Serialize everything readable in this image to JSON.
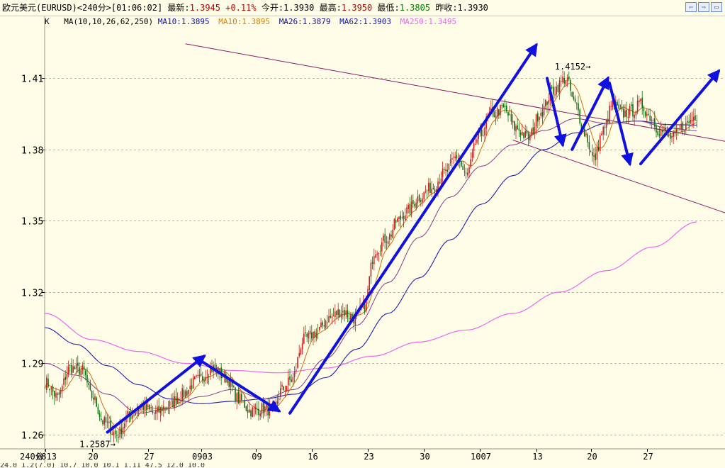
{
  "header": {
    "symbol": "欧元美元(EURUSD)<240分>",
    "time": "[01:06:02]",
    "latest_label": "最新:",
    "latest_value": "1.3945",
    "change": "+0.11%",
    "open_label": "今开:",
    "open_value": "1.3930",
    "high_label": "最高:",
    "high_value": "1.3950",
    "low_label": "最低:",
    "low_value": "1.3805",
    "prevclose_label": "昨收:",
    "prevclose_value": "1.3930"
  },
  "ma_legend": {
    "k_label": "K",
    "ma_def": "MA(10,10,26,62,250)",
    "items": [
      {
        "text": "MA10:1.3895",
        "color": "#1010c0"
      },
      {
        "text": "MA10:1.3895",
        "color": "#e08000"
      },
      {
        "text": "MA26:1.3879",
        "color": "#101090"
      },
      {
        "text": "MA62:1.3903",
        "color": "#1010c0"
      },
      {
        "text": "MA250:1.3495",
        "color": "#ee66ee"
      }
    ]
  },
  "colors": {
    "background": "#fffde8",
    "candle_up": "#d02020",
    "candle_down": "#107010",
    "arrow": "#1010e0",
    "channel": "#8b1a6b",
    "ma_short": "#d07010",
    "ma_mid": "#8b3a8b",
    "ma_long": "#2020b0",
    "ma250": "#ee66ee",
    "grid": "#b8b6a0"
  },
  "chart_data": {
    "type": "candlestick",
    "period_label": "240分",
    "x_ticks": [
      {
        "label": "0813",
        "index": 0
      },
      {
        "label": "20",
        "index": 30
      },
      {
        "label": "27",
        "index": 66
      },
      {
        "label": "0903",
        "index": 100
      },
      {
        "label": "09",
        "index": 135
      },
      {
        "label": "16",
        "index": 171
      },
      {
        "label": "23",
        "index": 207
      },
      {
        "label": "30",
        "index": 243
      },
      {
        "label": "1007",
        "index": 279
      },
      {
        "label": "13",
        "index": 315
      },
      {
        "label": "20",
        "index": 350
      },
      {
        "label": "27",
        "index": 386
      }
    ],
    "y_ticks": [
      1.26,
      1.29,
      1.32,
      1.35,
      1.38,
      1.41
    ],
    "ylim": [
      1.254,
      1.431
    ],
    "x_range": [
      0,
      440
    ],
    "candle_count": 418,
    "close_anchors": [
      [
        0,
        1.282
      ],
      [
        8,
        1.276
      ],
      [
        16,
        1.288
      ],
      [
        24,
        1.287
      ],
      [
        30,
        1.276
      ],
      [
        38,
        1.265
      ],
      [
        46,
        1.26
      ],
      [
        54,
        1.268
      ],
      [
        62,
        1.272
      ],
      [
        70,
        1.269
      ],
      [
        78,
        1.272
      ],
      [
        88,
        1.277
      ],
      [
        98,
        1.283
      ],
      [
        108,
        1.288
      ],
      [
        116,
        1.284
      ],
      [
        124,
        1.275
      ],
      [
        132,
        1.27
      ],
      [
        140,
        1.271
      ],
      [
        146,
        1.27
      ],
      [
        152,
        1.279
      ],
      [
        158,
        1.283
      ],
      [
        166,
        1.3
      ],
      [
        174,
        1.303
      ],
      [
        182,
        1.309
      ],
      [
        190,
        1.312
      ],
      [
        198,
        1.309
      ],
      [
        204,
        1.313
      ],
      [
        212,
        1.338
      ],
      [
        220,
        1.343
      ],
      [
        226,
        1.35
      ],
      [
        232,
        1.354
      ],
      [
        240,
        1.36
      ],
      [
        248,
        1.364
      ],
      [
        256,
        1.37
      ],
      [
        264,
        1.377
      ],
      [
        270,
        1.369
      ],
      [
        278,
        1.385
      ],
      [
        286,
        1.395
      ],
      [
        294,
        1.397
      ],
      [
        302,
        1.389
      ],
      [
        310,
        1.385
      ],
      [
        318,
        1.396
      ],
      [
        326,
        1.405
      ],
      [
        334,
        1.41
      ],
      [
        340,
        1.399
      ],
      [
        346,
        1.387
      ],
      [
        352,
        1.376
      ],
      [
        358,
        1.388
      ],
      [
        364,
        1.399
      ],
      [
        370,
        1.395
      ],
      [
        376,
        1.396
      ],
      [
        382,
        1.399
      ],
      [
        388,
        1.394
      ],
      [
        394,
        1.388
      ],
      [
        402,
        1.385
      ],
      [
        410,
        1.39
      ],
      [
        418,
        1.3945
      ]
    ],
    "ma250_anchors": [
      [
        0,
        1.311
      ],
      [
        30,
        1.3
      ],
      [
        60,
        1.295
      ],
      [
        90,
        1.29
      ],
      [
        120,
        1.287
      ],
      [
        150,
        1.286
      ],
      [
        180,
        1.288
      ],
      [
        210,
        1.293
      ],
      [
        240,
        1.299
      ],
      [
        270,
        1.304
      ],
      [
        300,
        1.311
      ],
      [
        330,
        1.32
      ],
      [
        360,
        1.329
      ],
      [
        390,
        1.339
      ],
      [
        418,
        1.3495
      ]
    ],
    "ma62_anchors": [
      [
        0,
        1.305
      ],
      [
        20,
        1.298
      ],
      [
        40,
        1.289
      ],
      [
        60,
        1.281
      ],
      [
        80,
        1.275
      ],
      [
        100,
        1.273
      ],
      [
        120,
        1.274
      ],
      [
        140,
        1.275
      ],
      [
        160,
        1.277
      ],
      [
        180,
        1.284
      ],
      [
        200,
        1.296
      ],
      [
        220,
        1.311
      ],
      [
        240,
        1.326
      ],
      [
        260,
        1.342
      ],
      [
        280,
        1.357
      ],
      [
        300,
        1.369
      ],
      [
        320,
        1.38
      ],
      [
        340,
        1.387
      ],
      [
        360,
        1.391
      ],
      [
        380,
        1.392
      ],
      [
        400,
        1.3905
      ],
      [
        418,
        1.3903
      ]
    ],
    "ma26_anchors": [
      [
        0,
        1.29
      ],
      [
        20,
        1.285
      ],
      [
        40,
        1.277
      ],
      [
        60,
        1.269
      ],
      [
        80,
        1.271
      ],
      [
        100,
        1.276
      ],
      [
        120,
        1.279
      ],
      [
        140,
        1.275
      ],
      [
        160,
        1.279
      ],
      [
        180,
        1.292
      ],
      [
        200,
        1.306
      ],
      [
        220,
        1.324
      ],
      [
        240,
        1.343
      ],
      [
        260,
        1.36
      ],
      [
        280,
        1.373
      ],
      [
        300,
        1.382
      ],
      [
        320,
        1.388
      ],
      [
        340,
        1.393
      ],
      [
        360,
        1.391
      ],
      [
        380,
        1.392
      ],
      [
        400,
        1.389
      ],
      [
        418,
        1.3879
      ]
    ],
    "annotations": [
      {
        "text": "1.2587",
        "index": 46,
        "price": 1.2587,
        "kind": "low"
      },
      {
        "text": "1.4152",
        "index": 326,
        "price": 1.4152,
        "kind": "high"
      }
    ],
    "channel_lines": [
      {
        "from": [
          90,
          1.4245
        ],
        "to": [
          440,
          1.383
        ]
      },
      {
        "from": [
          300,
          1.384
        ],
        "to": [
          440,
          1.3525
        ]
      }
    ],
    "arrows": [
      {
        "from": [
          40,
          1.261
        ],
        "to": [
          102,
          1.293
        ]
      },
      {
        "from": [
          100,
          1.291
        ],
        "to": [
          150,
          1.27
        ]
      },
      {
        "from": [
          157,
          1.269
        ],
        "to": [
          315,
          1.424
        ]
      },
      {
        "from": [
          322,
          1.41
        ],
        "to": [
          332,
          1.382
        ]
      },
      {
        "from": [
          338,
          1.38
        ],
        "to": [
          361,
          1.41
        ]
      },
      {
        "from": [
          362,
          1.408
        ],
        "to": [
          375,
          1.374
        ]
      },
      {
        "from": [
          382,
          1.374
        ],
        "to": [
          432,
          1.413
        ]
      }
    ]
  },
  "statusbar": {
    "text": "24.0 1.2(7.0)  10.7 10.0 10.1  1.11  47.5 12.0 10.0"
  }
}
